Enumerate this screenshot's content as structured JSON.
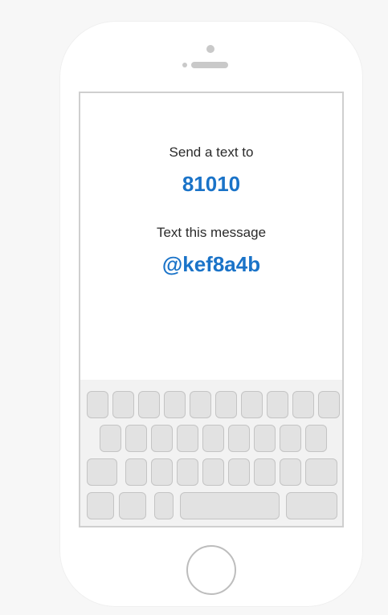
{
  "screen": {
    "send_label": "Send a text to",
    "number": "81010",
    "message_label": "Text this message",
    "code": "@kef8a4b"
  },
  "colors": {
    "accent": "#1a73c8",
    "key_fill": "#e2e2e2",
    "key_border": "#c4c4c4"
  },
  "icons": [
    "camera-icon",
    "speaker-icon",
    "home-button-icon"
  ]
}
